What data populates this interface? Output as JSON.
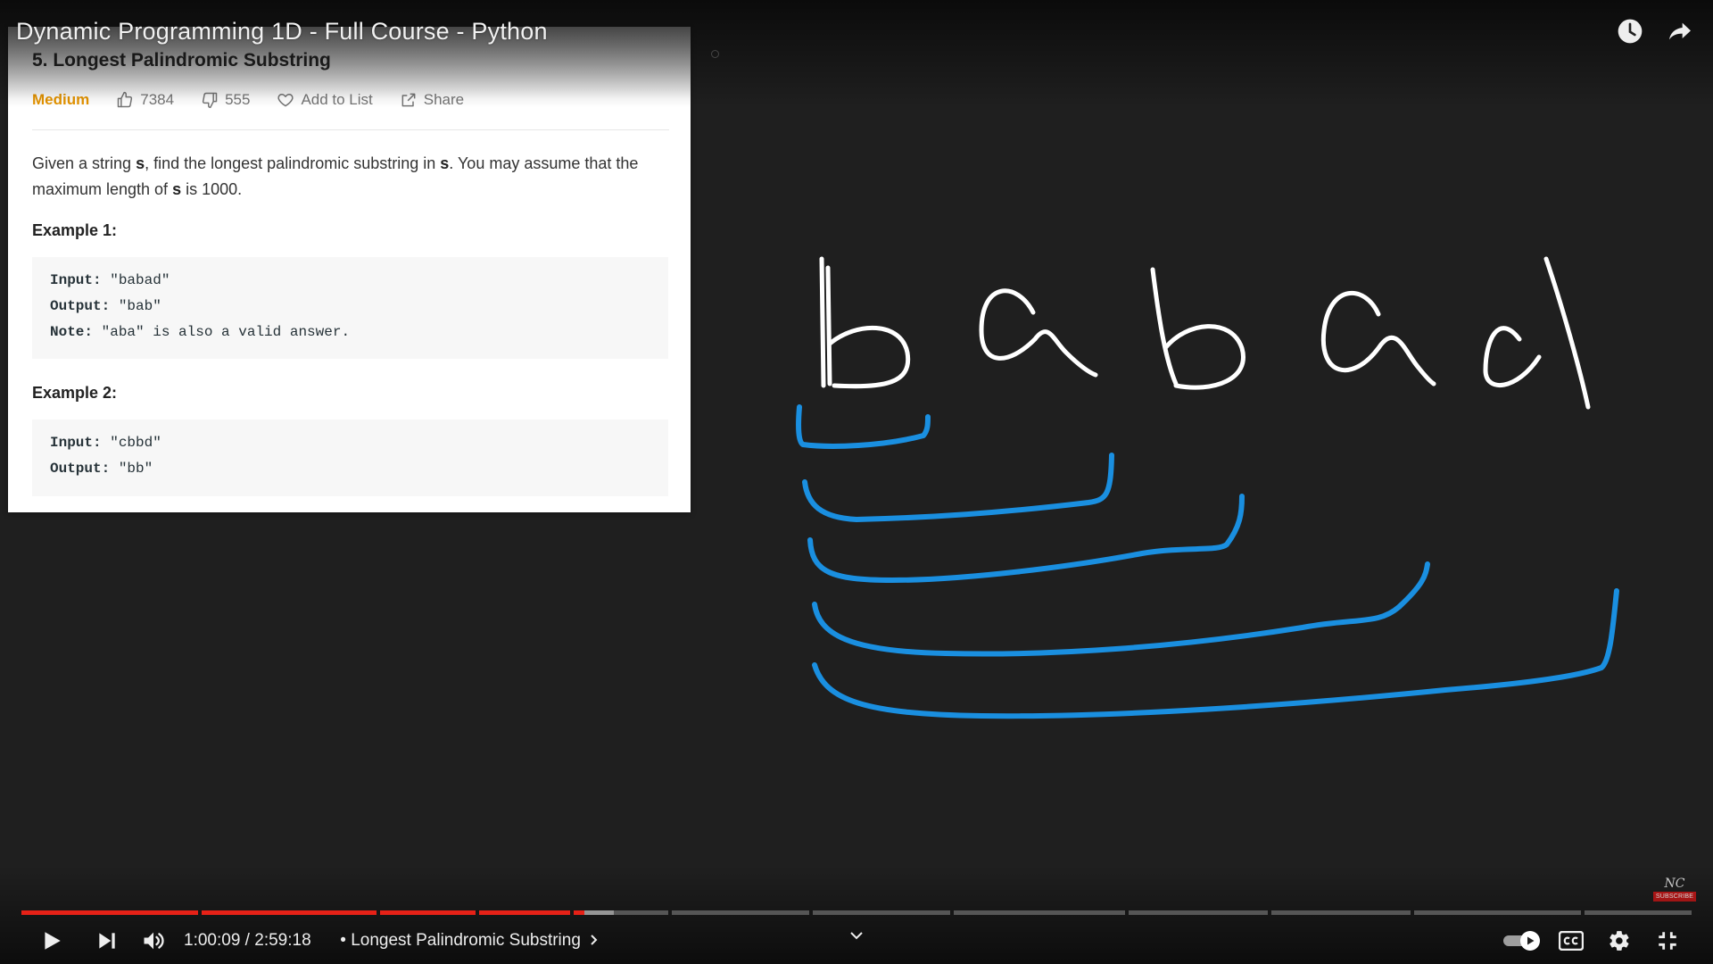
{
  "video": {
    "title": "Dynamic Programming 1D - Full Course - Python"
  },
  "problem": {
    "title": "5. Longest Palindromic Substring",
    "difficulty": "Medium",
    "likes": "7384",
    "dislikes": "555",
    "add_to_list": "Add to List",
    "share": "Share",
    "description": {
      "p1": "Given a string ",
      "s1": "s",
      "p2": ", find the longest palindromic substring in ",
      "s2": "s",
      "p3": ". You may assume that the maximum length of ",
      "s3": "s",
      "p4": " is 1000."
    },
    "example1": {
      "heading": "Example 1:",
      "input_key": "Input:",
      "input_val": " \"babad\"",
      "output_key": "Output:",
      "output_val": " \"bab\"",
      "note_key": "Note:",
      "note_val": " \"aba\" is also a valid answer."
    },
    "example2": {
      "heading": "Example 2:",
      "input_key": "Input:",
      "input_val": " \"cbbd\"",
      "output_key": "Output:",
      "output_val": " \"bb\""
    }
  },
  "drawing": {
    "letters": [
      "b",
      "a",
      "b",
      "a",
      "d"
    ],
    "bracket_color": "#1a8fe0"
  },
  "watermark": {
    "signature": "NC",
    "subscribe": "SUBSCRIBE"
  },
  "player": {
    "current_time": "1:00:09",
    "separator": " / ",
    "duration": "2:59:18",
    "chapter_prefix": " • ",
    "chapter_title": "Longest Palindromic Substring",
    "played_color": "#e62117"
  },
  "icons": {
    "watch_later": "clock-icon",
    "share": "share-arrow-icon",
    "play": "play-icon",
    "next": "next-icon",
    "volume": "volume-icon",
    "chapter_chevron": "chevron-right-icon",
    "dropdown": "chevron-down-icon",
    "autoplay": "autoplay-toggle-icon",
    "captions": "cc-icon",
    "settings": "gear-icon",
    "exit_fullscreen": "exit-fullscreen-icon"
  }
}
